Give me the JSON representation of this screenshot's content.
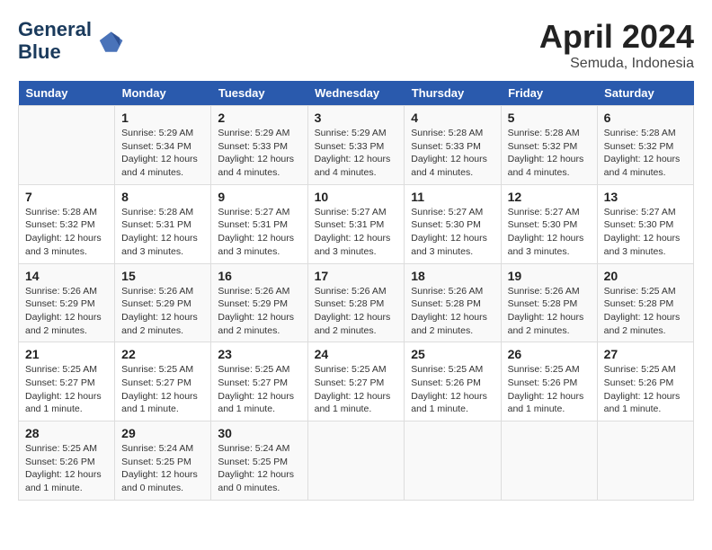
{
  "header": {
    "logo_line1": "General",
    "logo_line2": "Blue",
    "month": "April 2024",
    "location": "Semuda, Indonesia"
  },
  "days_of_week": [
    "Sunday",
    "Monday",
    "Tuesday",
    "Wednesday",
    "Thursday",
    "Friday",
    "Saturday"
  ],
  "weeks": [
    [
      {
        "day": "",
        "info": ""
      },
      {
        "day": "1",
        "info": "Sunrise: 5:29 AM\nSunset: 5:34 PM\nDaylight: 12 hours\nand 4 minutes."
      },
      {
        "day": "2",
        "info": "Sunrise: 5:29 AM\nSunset: 5:33 PM\nDaylight: 12 hours\nand 4 minutes."
      },
      {
        "day": "3",
        "info": "Sunrise: 5:29 AM\nSunset: 5:33 PM\nDaylight: 12 hours\nand 4 minutes."
      },
      {
        "day": "4",
        "info": "Sunrise: 5:28 AM\nSunset: 5:33 PM\nDaylight: 12 hours\nand 4 minutes."
      },
      {
        "day": "5",
        "info": "Sunrise: 5:28 AM\nSunset: 5:32 PM\nDaylight: 12 hours\nand 4 minutes."
      },
      {
        "day": "6",
        "info": "Sunrise: 5:28 AM\nSunset: 5:32 PM\nDaylight: 12 hours\nand 4 minutes."
      }
    ],
    [
      {
        "day": "7",
        "info": "Sunrise: 5:28 AM\nSunset: 5:32 PM\nDaylight: 12 hours\nand 3 minutes."
      },
      {
        "day": "8",
        "info": "Sunrise: 5:28 AM\nSunset: 5:31 PM\nDaylight: 12 hours\nand 3 minutes."
      },
      {
        "day": "9",
        "info": "Sunrise: 5:27 AM\nSunset: 5:31 PM\nDaylight: 12 hours\nand 3 minutes."
      },
      {
        "day": "10",
        "info": "Sunrise: 5:27 AM\nSunset: 5:31 PM\nDaylight: 12 hours\nand 3 minutes."
      },
      {
        "day": "11",
        "info": "Sunrise: 5:27 AM\nSunset: 5:30 PM\nDaylight: 12 hours\nand 3 minutes."
      },
      {
        "day": "12",
        "info": "Sunrise: 5:27 AM\nSunset: 5:30 PM\nDaylight: 12 hours\nand 3 minutes."
      },
      {
        "day": "13",
        "info": "Sunrise: 5:27 AM\nSunset: 5:30 PM\nDaylight: 12 hours\nand 3 minutes."
      }
    ],
    [
      {
        "day": "14",
        "info": "Sunrise: 5:26 AM\nSunset: 5:29 PM\nDaylight: 12 hours\nand 2 minutes."
      },
      {
        "day": "15",
        "info": "Sunrise: 5:26 AM\nSunset: 5:29 PM\nDaylight: 12 hours\nand 2 minutes."
      },
      {
        "day": "16",
        "info": "Sunrise: 5:26 AM\nSunset: 5:29 PM\nDaylight: 12 hours\nand 2 minutes."
      },
      {
        "day": "17",
        "info": "Sunrise: 5:26 AM\nSunset: 5:28 PM\nDaylight: 12 hours\nand 2 minutes."
      },
      {
        "day": "18",
        "info": "Sunrise: 5:26 AM\nSunset: 5:28 PM\nDaylight: 12 hours\nand 2 minutes."
      },
      {
        "day": "19",
        "info": "Sunrise: 5:26 AM\nSunset: 5:28 PM\nDaylight: 12 hours\nand 2 minutes."
      },
      {
        "day": "20",
        "info": "Sunrise: 5:25 AM\nSunset: 5:28 PM\nDaylight: 12 hours\nand 2 minutes."
      }
    ],
    [
      {
        "day": "21",
        "info": "Sunrise: 5:25 AM\nSunset: 5:27 PM\nDaylight: 12 hours\nand 1 minute."
      },
      {
        "day": "22",
        "info": "Sunrise: 5:25 AM\nSunset: 5:27 PM\nDaylight: 12 hours\nand 1 minute."
      },
      {
        "day": "23",
        "info": "Sunrise: 5:25 AM\nSunset: 5:27 PM\nDaylight: 12 hours\nand 1 minute."
      },
      {
        "day": "24",
        "info": "Sunrise: 5:25 AM\nSunset: 5:27 PM\nDaylight: 12 hours\nand 1 minute."
      },
      {
        "day": "25",
        "info": "Sunrise: 5:25 AM\nSunset: 5:26 PM\nDaylight: 12 hours\nand 1 minute."
      },
      {
        "day": "26",
        "info": "Sunrise: 5:25 AM\nSunset: 5:26 PM\nDaylight: 12 hours\nand 1 minute."
      },
      {
        "day": "27",
        "info": "Sunrise: 5:25 AM\nSunset: 5:26 PM\nDaylight: 12 hours\nand 1 minute."
      }
    ],
    [
      {
        "day": "28",
        "info": "Sunrise: 5:25 AM\nSunset: 5:26 PM\nDaylight: 12 hours\nand 1 minute."
      },
      {
        "day": "29",
        "info": "Sunrise: 5:24 AM\nSunset: 5:25 PM\nDaylight: 12 hours\nand 0 minutes."
      },
      {
        "day": "30",
        "info": "Sunrise: 5:24 AM\nSunset: 5:25 PM\nDaylight: 12 hours\nand 0 minutes."
      },
      {
        "day": "",
        "info": ""
      },
      {
        "day": "",
        "info": ""
      },
      {
        "day": "",
        "info": ""
      },
      {
        "day": "",
        "info": ""
      }
    ]
  ]
}
